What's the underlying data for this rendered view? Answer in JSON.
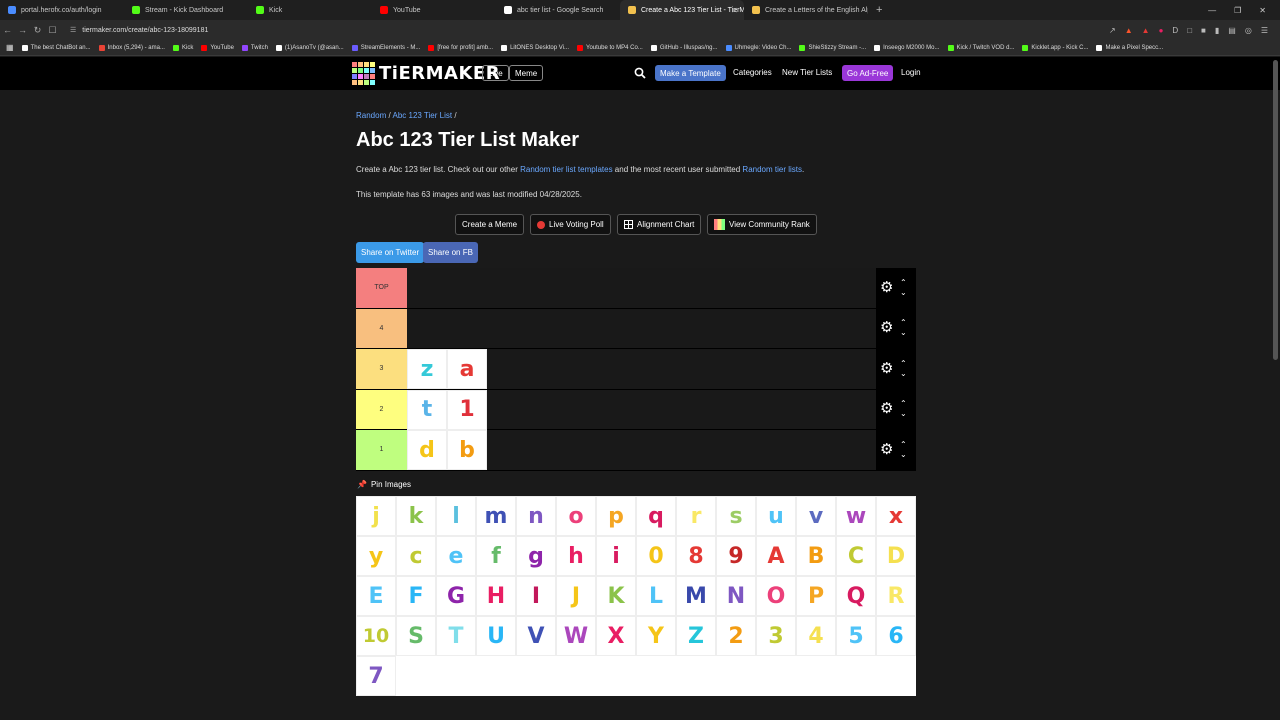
{
  "browser": {
    "tabs": [
      {
        "label": "portal.herofx.co/auth/login",
        "color": "#4a8cff",
        "active": false
      },
      {
        "label": "Stream - Kick Dashboard",
        "color": "#53fc18",
        "active": false
      },
      {
        "label": "Kick",
        "color": "#53fc18",
        "active": false
      },
      {
        "label": "YouTube",
        "color": "#ff0000",
        "active": false
      },
      {
        "label": "abc tier list - Google Search",
        "color": "#ffffff",
        "active": false
      },
      {
        "label": "Create a Abc 123 Tier List - TierM",
        "color": "#f2c14e",
        "active": true
      },
      {
        "label": "Create a Letters of the English Alpha",
        "color": "#f2c14e",
        "active": false
      }
    ],
    "url": "tiermaker.com/create/abc-123-18099181",
    "bookmarks": [
      {
        "label": "The best ChatBot an...",
        "color": "#fff"
      },
      {
        "label": "Inbox (5,294) - ama...",
        "color": "#ea4335"
      },
      {
        "label": "Kick",
        "color": "#53fc18"
      },
      {
        "label": "YouTube",
        "color": "#ff0000"
      },
      {
        "label": "Twitch",
        "color": "#9146ff"
      },
      {
        "label": "(1)AsanoTv (@asan...",
        "color": "#fff"
      },
      {
        "label": "StreamElements - M...",
        "color": "#6b5cff"
      },
      {
        "label": "[free for profit] amb...",
        "color": "#ff0000"
      },
      {
        "label": "LitONES Desktop Vi...",
        "color": "#fff"
      },
      {
        "label": "Youtube to MP4 Co...",
        "color": "#ff0000"
      },
      {
        "label": "GitHub - Illuspas/ng...",
        "color": "#fff"
      },
      {
        "label": "Uhmegle: Video Ch...",
        "color": "#4a8cff"
      },
      {
        "label": "ShieStizzy Stream -...",
        "color": "#53fc18"
      },
      {
        "label": "Inseego M2000 Mo...",
        "color": "#fff"
      },
      {
        "label": "Kick / Twitch VOD d...",
        "color": "#53fc18"
      },
      {
        "label": "Kicklet.app - Kick C...",
        "color": "#53fc18"
      },
      {
        "label": "Make a Pixel Specc...",
        "color": "#fff"
      }
    ]
  },
  "header": {
    "logo": "TiERMAKER",
    "live": "Live",
    "meme": "Meme",
    "make_template": "Make a Template",
    "categories": "Categories",
    "new_lists": "New Tier Lists",
    "ad_free": "Go Ad-Free",
    "login": "Login"
  },
  "breadcrumb": {
    "root": "Random",
    "current": "Abc 123 Tier List",
    "sep": "/"
  },
  "title": "Abc 123 Tier List Maker",
  "desc": {
    "pre": "Create a Abc 123 tier list. Check out our other ",
    "link1": "Random tier list templates",
    "mid": " and the most recent user submitted ",
    "link2": "Random tier lists",
    "post": "."
  },
  "meta": "This template has 63 images and was last modified 04/28/2025.",
  "actions": {
    "meme": "Create a Meme",
    "poll": "Live Voting Poll",
    "align": "Alignment Chart",
    "rank": "View Community Rank"
  },
  "share": {
    "twitter": "Share on Twitter",
    "fb": "Share on FB"
  },
  "tiers": [
    {
      "label": "TOP",
      "color": "#f47f7f",
      "items": []
    },
    {
      "label": "4",
      "color": "#f8bf7f",
      "items": []
    },
    {
      "label": "3",
      "color": "#fcdf7f",
      "items": [
        {
          "ch": "z",
          "color": "#35c9d8"
        },
        {
          "ch": "a",
          "color": "#e53935"
        }
      ]
    },
    {
      "label": "2",
      "color": "#fefe7f",
      "items": [
        {
          "ch": "t",
          "color": "#5ab4e8"
        },
        {
          "ch": "1",
          "color": "#e0303a"
        }
      ]
    },
    {
      "label": "1",
      "color": "#bffe7f",
      "items": [
        {
          "ch": "d",
          "color": "#f5c518"
        },
        {
          "ch": "b",
          "color": "#f39c12"
        }
      ]
    }
  ],
  "pin_label": "Pin Images",
  "bank": [
    {
      "ch": "j",
      "color": "#f2e14c"
    },
    {
      "ch": "k",
      "color": "#8bc34a"
    },
    {
      "ch": "l",
      "color": "#5bc0de"
    },
    {
      "ch": "m",
      "color": "#3f51b5"
    },
    {
      "ch": "n",
      "color": "#7e57c2"
    },
    {
      "ch": "o",
      "color": "#ec407a"
    },
    {
      "ch": "p",
      "color": "#f5a623"
    },
    {
      "ch": "q",
      "color": "#d81b60"
    },
    {
      "ch": "r",
      "color": "#f9e866"
    },
    {
      "ch": "s",
      "color": "#9ccc65"
    },
    {
      "ch": "u",
      "color": "#4fc3f7"
    },
    {
      "ch": "v",
      "color": "#5c6bc0"
    },
    {
      "ch": "w",
      "color": "#ab47bc"
    },
    {
      "ch": "x",
      "color": "#e53935"
    },
    {
      "ch": "y",
      "color": "#f5c518"
    },
    {
      "ch": "c",
      "color": "#c0ca33"
    },
    {
      "ch": "e",
      "color": "#4fc3f7"
    },
    {
      "ch": "f",
      "color": "#66bb6a"
    },
    {
      "ch": "g",
      "color": "#8e24aa"
    },
    {
      "ch": "h",
      "color": "#e91e63"
    },
    {
      "ch": "i",
      "color": "#d81b60"
    },
    {
      "ch": "0",
      "color": "#f5c518"
    },
    {
      "ch": "8",
      "color": "#e53935"
    },
    {
      "ch": "9",
      "color": "#c62828"
    },
    {
      "ch": "A",
      "color": "#e53935"
    },
    {
      "ch": "B",
      "color": "#f39c12"
    },
    {
      "ch": "C",
      "color": "#c0ca33"
    },
    {
      "ch": "D",
      "color": "#f5e050"
    },
    {
      "ch": "E",
      "color": "#4fc3f7"
    },
    {
      "ch": "F",
      "color": "#29b6f6"
    },
    {
      "ch": "G",
      "color": "#8e24aa"
    },
    {
      "ch": "H",
      "color": "#e91e63"
    },
    {
      "ch": "I",
      "color": "#c2185b"
    },
    {
      "ch": "J",
      "color": "#f5c518"
    },
    {
      "ch": "K",
      "color": "#8bc34a"
    },
    {
      "ch": "L",
      "color": "#4fc3f7"
    },
    {
      "ch": "M",
      "color": "#3949ab"
    },
    {
      "ch": "N",
      "color": "#7e57c2"
    },
    {
      "ch": "O",
      "color": "#ec407a"
    },
    {
      "ch": "P",
      "color": "#f5a623"
    },
    {
      "ch": "Q",
      "color": "#d81b60"
    },
    {
      "ch": "R",
      "color": "#f9e866"
    },
    {
      "ch": "10",
      "color": "#c0ca33"
    },
    {
      "ch": "S",
      "color": "#66bb6a"
    },
    {
      "ch": "T",
      "color": "#80deea"
    },
    {
      "ch": "U",
      "color": "#29b6f6"
    },
    {
      "ch": "V",
      "color": "#3f51b5"
    },
    {
      "ch": "W",
      "color": "#ab47bc"
    },
    {
      "ch": "X",
      "color": "#e91e63"
    },
    {
      "ch": "Y",
      "color": "#f5c518"
    },
    {
      "ch": "Z",
      "color": "#26c6da"
    },
    {
      "ch": "2",
      "color": "#f39c12"
    },
    {
      "ch": "3",
      "color": "#c0ca33"
    },
    {
      "ch": "4",
      "color": "#f5e050"
    },
    {
      "ch": "5",
      "color": "#4fc3f7"
    },
    {
      "ch": "6",
      "color": "#29b6f6"
    },
    {
      "ch": "7",
      "color": "#7e57c2"
    }
  ]
}
